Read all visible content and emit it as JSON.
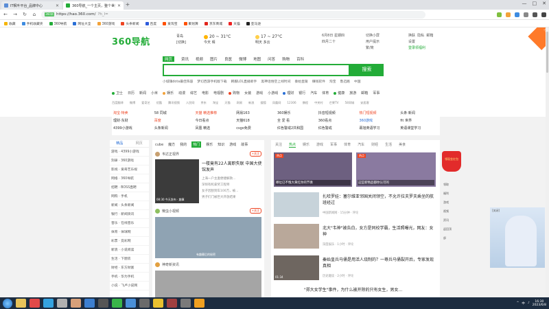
{
  "browser": {
    "tabs": [
      {
        "title": "IT枫叶平台_品牌中心",
        "color": "#5b8dd6",
        "active": false
      },
      {
        "title": "360导航_一个主页，整个世界",
        "color": "#23ac38",
        "active": true
      }
    ],
    "new_tab": "+",
    "window_controls": [
      "—",
      "□",
      "✕"
    ],
    "url_secure_label": "360浏览",
    "url": "https://hao.360.com/",
    "url_suffix": "?h_l=",
    "bookmarks": [
      "收藏",
      "手机收藏夹",
      "360导航",
      "网址大全",
      "360游戏",
      "头条新闻",
      "百度",
      "爱淘宝",
      "聚划算",
      "京东商城",
      "天猫",
      "亚马逊"
    ]
  },
  "header": {
    "logo": "360导航",
    "city": "青岛",
    "city_switch": "[切换]",
    "weather_today": {
      "temp": "20 ~ 31°C",
      "desc": "今天 晴"
    },
    "weather_tomorrow": {
      "temp": "17 ~ 27°C",
      "desc": "明天 多云"
    },
    "date_line": "6月8日 星期四",
    "lunar": "四月二十",
    "tool_1": "切换小屏",
    "tool_2": "用户提示",
    "tool_3": "繁/简",
    "right_1": "换肤",
    "right_2": "隐私",
    "right_3": "邮箱",
    "right_4": "设置",
    "login": "登录领福利",
    "corner": "大版"
  },
  "search": {
    "tabs": [
      "网页",
      "资讯",
      "视频",
      "图片",
      "良医",
      "微博",
      "地图",
      "问答",
      "购物",
      "百科"
    ],
    "active_tab": "网页",
    "value": "",
    "button": "搜索",
    "hot": [
      "小城镇dota最佳阵容",
      "梦幻西游手机版下载",
      "韩服LOL直播新手",
      "黑神话悟空上线时间",
      "秦始皇陵",
      "赚钱软件",
      "淘宝",
      "鲁迅路",
      "中国"
    ]
  },
  "quick_links": [
    "卫士",
    "日历",
    "新闻",
    "小米",
    "娱乐",
    "动漫",
    "综艺",
    "电影",
    "电视剧",
    "购物",
    "女装",
    "游戏",
    "小游戏",
    "理财",
    "银行",
    "汽车",
    "体育",
    "健康",
    "旅游",
    "邮箱",
    "军事"
  ],
  "sub_links": [
    "百度翻译",
    "微博",
    "爱奇艺",
    "优酷",
    "腾讯视频",
    "人民网",
    "京东",
    "淘宝",
    "天猫",
    "网易",
    "新浪",
    "搜狐",
    "凤凰网",
    "12306",
    "携程",
    "中关村",
    "芒果TV",
    "58同城",
    "安居客"
  ],
  "site_grid": [
    {
      "t": "淘宝·特卖",
      "c": "red"
    },
    {
      "t": "58 同城",
      "c": ""
    },
    {
      "t": "天猫 精选推荐",
      "c": "red"
    },
    {
      "t": "网易163",
      "c": ""
    },
    {
      "t": "360娱乐",
      "c": ""
    },
    {
      "t": "抖音短视频",
      "c": ""
    },
    {
      "t": "热门短视频",
      "c": "red"
    },
    {
      "t": "头条·新闻",
      "c": ""
    },
    {
      "t": "理财·东财",
      "c": ""
    },
    {
      "t": "百度",
      "c": "red"
    },
    {
      "t": "今日看点",
      "c": ""
    },
    {
      "t": "天猫618",
      "c": ""
    },
    {
      "t": "全 爱 看",
      "c": ""
    },
    {
      "t": "360看点",
      "c": ""
    },
    {
      "t": "360游戏",
      "c": "blu"
    },
    {
      "t": "fit 世界",
      "c": ""
    },
    {
      "t": "4399小游戏",
      "c": ""
    },
    {
      "t": "头条新闻",
      "c": ""
    },
    {
      "t": "凤凰 精选",
      "c": ""
    },
    {
      "t": "csgo免费",
      "c": ""
    },
    {
      "t": "红色警戒2共和国",
      "c": ""
    },
    {
      "t": "红色警戒",
      "c": ""
    },
    {
      "t": "幕旭英语学习",
      "c": ""
    },
    {
      "t": "英语课堂学习",
      "c": ""
    }
  ],
  "left_col": {
    "tabs": [
      "精品",
      "网页"
    ],
    "items": [
      "游戏 · 4399小游戏",
      "刻录 · 360游戏",
      "影视 · 爱奇艺乐视",
      "网络 · 360导航",
      "招聘 · BOSS直聘",
      "网购 · 手机",
      "新闻 · 头条新闻",
      "银行 · 新闻资讯",
      "音乐 · 在线音乐",
      "体育 · 体球网",
      "彩票 · 竞彩网",
      "新浪 · 小说阅读",
      "生活 · 下厨房",
      "财经 · 东方财富",
      "手机 · 华为手机",
      "小说 · 飞卢小说网"
    ]
  },
  "middle_col": {
    "tabs": [
      "cube",
      "魔方",
      "我的",
      "热门",
      "娱乐",
      "知识",
      "游戏",
      "故事"
    ],
    "active_tab": "热门",
    "follow": "+关注",
    "block1": {
      "author": "韦达正视界",
      "title": "一楼竟有22人离职失联 中国大使馆发声",
      "lines": [
        "上海一户主妻便捷解救...",
        "深圳有机拿奖工程师",
        "女子因刮到车100万，被...",
        "男子们门被巨大开放结果"
      ],
      "video_caption": "08:30 今天发布 · 趣事"
    },
    "block2": {
      "author": "懒虫小视频",
      "caption": "有趣幕后的秘密"
    },
    "block3": {
      "author": "神奇新资讯"
    }
  },
  "right_col": {
    "tabs": [
      "关注",
      "热点",
      "娱乐",
      "游戏",
      "军事",
      "体育",
      "汽车",
      "财经",
      "生活",
      "美食"
    ],
    "active_tab": "热点",
    "tiles": [
      {
        "tag": "热点",
        "cap": "哪位已不愧大黄红你的节奏"
      },
      {
        "tag": "热点",
        "cap": "这些新物品都你认可的"
      }
    ],
    "news": [
      {
        "title": "扎哈罗娃：塞尔维亚邻国关闭领空，不允许拉夫罗夫乘坐的航班经过",
        "src": "中国新闻网 · 15分钟 · 评论"
      },
      {
        "title": "北大\"韦神\"被告白，女方是同校学霸，生活照曝光，网友：女神",
        "src": "深度娱乐 · 1小时 · 评论"
      },
      {
        "title": "秦始皇兵马俑是用活人烧制的？一尊兵马俑裂开后，专家发现真相",
        "src": "历史趣谈 · 2小时 · 评论",
        "dur": "01:34"
      },
      {
        "title": "\"郑大女学生\"事件，为什么被开除的只有女生，男女...",
        "src": ""
      }
    ]
  },
  "side_tools": [
    "领取",
    "福利",
    "游戏",
    "视频",
    "资讯",
    "返回顶部"
  ],
  "redbag": "领现金红包",
  "float_ad": {
    "close": "[关闭]"
  },
  "taskbar": {
    "clock_time": "16:30",
    "clock_date": "2023/6/8",
    "tray_text": "中"
  }
}
